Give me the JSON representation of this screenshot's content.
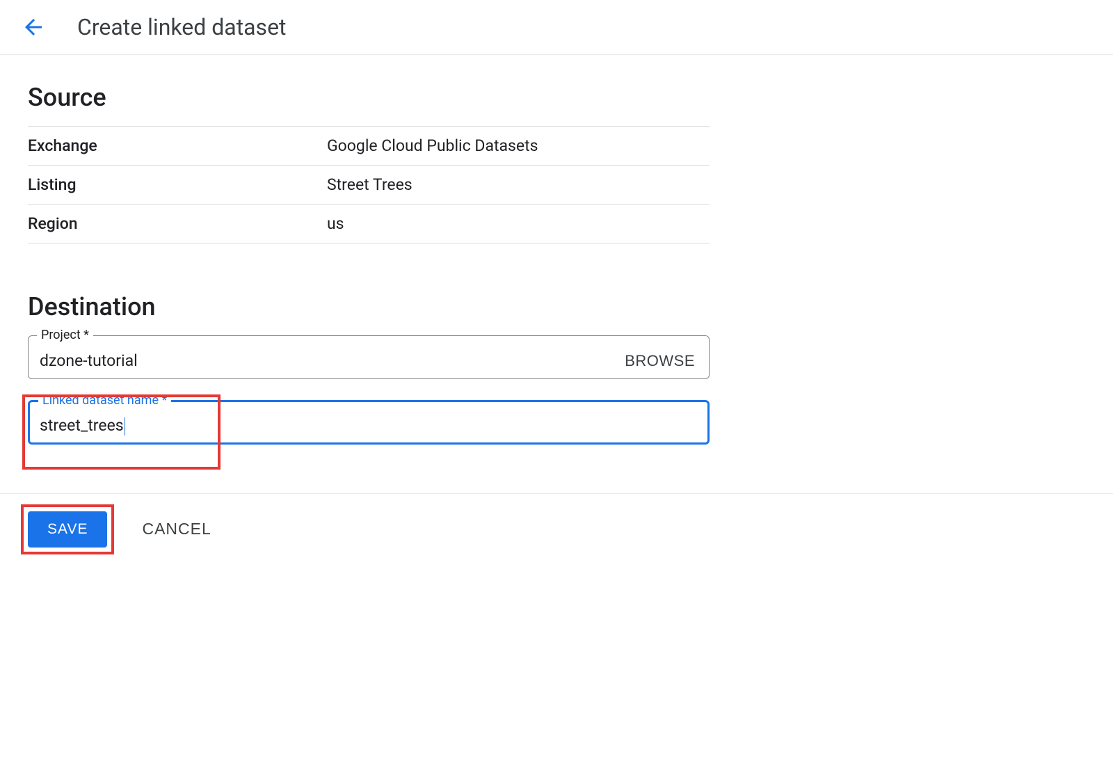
{
  "header": {
    "title": "Create linked dataset"
  },
  "source": {
    "section_title": "Source",
    "rows": [
      {
        "label": "Exchange",
        "value": "Google Cloud Public Datasets"
      },
      {
        "label": "Listing",
        "value": "Street Trees"
      },
      {
        "label": "Region",
        "value": "us"
      }
    ]
  },
  "destination": {
    "section_title": "Destination",
    "project_label": "Project *",
    "project_value": "dzone-tutorial",
    "browse_label": "BROWSE",
    "dataset_label": "Linked dataset name *",
    "dataset_value": "street_trees"
  },
  "footer": {
    "save_label": "SAVE",
    "cancel_label": "CANCEL"
  }
}
